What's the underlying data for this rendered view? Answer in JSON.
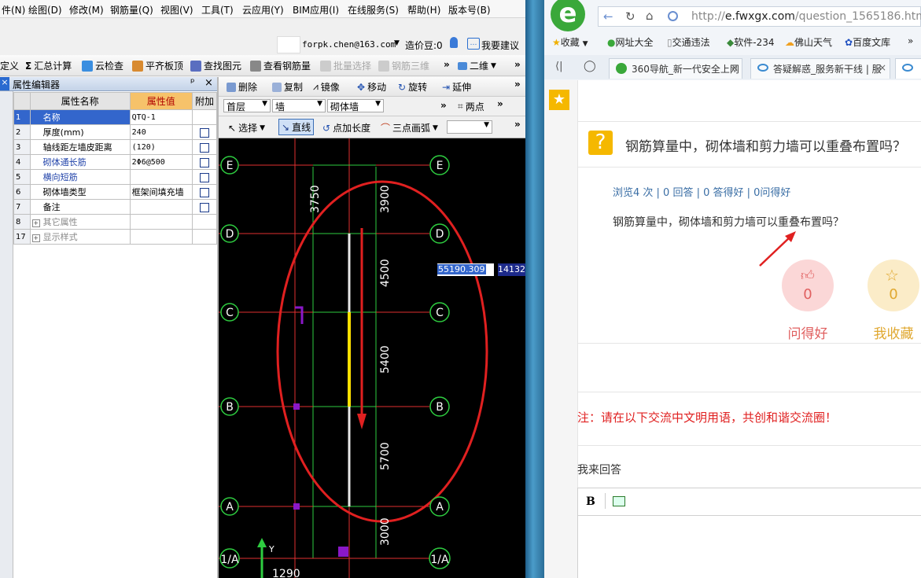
{
  "app": {
    "menu": [
      "件(N)",
      "绘图(D)",
      "修改(M)",
      "钢筋量(Q)",
      "视图(V)",
      "工具(T)",
      "云应用(Y)",
      "BIM应用(I)",
      "在线服务(S)",
      "帮助(H)",
      "版本号(B)"
    ],
    "account": "forpk.chen@163.com",
    "price_beans": "造价豆:0",
    "suggest": "我要建议",
    "toolbar": {
      "define": "定义",
      "summary": "汇总计算",
      "cloud_check": "云检查",
      "level_top": "平齐板顶",
      "find_element": "查找图元",
      "view_rebar": "查看钢筋量",
      "batch_select": "批量选择",
      "rebar_3d": "钢筋三维",
      "view_mode": "二维"
    },
    "property_panel": {
      "title": "属性编辑器",
      "pin": "ᵖ",
      "close": "×",
      "headers": {
        "name": "属性名称",
        "value": "属性值",
        "extra": "附加"
      },
      "rows": [
        {
          "idx": "1",
          "name": "名称",
          "value": "QTQ-1",
          "check": false
        },
        {
          "idx": "2",
          "name": "厚度(mm)",
          "value": "240",
          "check": true
        },
        {
          "idx": "3",
          "name": "轴线距左墙皮距离",
          "value": "(120)",
          "check": true
        },
        {
          "idx": "4",
          "name": "砌体通长筋",
          "value": "2Φ6@500",
          "check": true
        },
        {
          "idx": "5",
          "name": "横向短筋",
          "value": "",
          "check": true
        },
        {
          "idx": "6",
          "name": "砌体墙类型",
          "value": "框架间填充墙",
          "check": true
        },
        {
          "idx": "7",
          "name": "备注",
          "value": "",
          "check": true
        },
        {
          "idx": "8",
          "name": "其它属性",
          "value": "",
          "check": false
        },
        {
          "idx": "17",
          "name": "显示样式",
          "value": "",
          "check": false
        }
      ]
    },
    "edit_toolbar": {
      "delete": "删除",
      "copy": "复制",
      "mirror": "镜像",
      "move": "移动",
      "rotate": "旋转",
      "extend": "延伸"
    },
    "floor_toolbar": {
      "floor": "首层",
      "type": "墙",
      "subtype": "砌体墙",
      "two_point": "两点"
    },
    "draw_toolbar": {
      "select": "选择",
      "line": "直线",
      "point_length": "点加长度",
      "arc": "三点画弧"
    },
    "canvas": {
      "axes_left": [
        "E",
        "D",
        "C",
        "B",
        "A",
        "1/A"
      ],
      "axes_right": [
        "E",
        "D",
        "C",
        "B",
        "A",
        "1/A"
      ],
      "dims": [
        "3750",
        "3900",
        "4500",
        "5400",
        "5700",
        "3000",
        "1290"
      ],
      "coord_x": "55190.309",
      "coord_y": "14132",
      "y_axis": "Y"
    }
  },
  "browser": {
    "url_prefix": "http://",
    "url_domain": "e.fwxgx.com",
    "url_path": "/question_1565186.html",
    "bookmarks": [
      "收藏",
      "网址大全",
      "交通违法",
      "软件-234",
      "佛山天气",
      "百度文库"
    ],
    "tabs": [
      "360导航_新一代安全上网",
      "答疑解惑_服务新干线 | 服"
    ],
    "question_title": "钢筋算量中，砌体墙和剪力墙可以重叠布置吗？",
    "stats": "浏览4 次 | 0 回答 | 0 答得好 | 0问得好",
    "question_body": "钢筋算量中，砌体墙和剪力墙可以重叠布置吗？",
    "like_count": "0",
    "like_label": "问得好",
    "fav_count": "0",
    "fav_label": "我收藏",
    "notice": "注：请在以下交流中文明用语，共创和谐交流圈！",
    "answer_label": "我来回答",
    "editor_bold": "B"
  },
  "colors": {
    "accent_red": "#e02020",
    "link_blue": "#3a6ea5",
    "grid_green": "#2ecc40",
    "axis_red": "#ff3030",
    "wall_yellow": "#ffe000",
    "magenta": "#8a18c8"
  }
}
